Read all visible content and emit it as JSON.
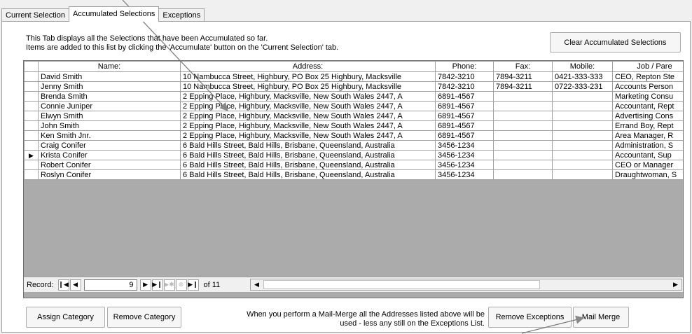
{
  "tabs": [
    {
      "label": "Current Selection"
    },
    {
      "label": "Accumulated Selections"
    },
    {
      "label": "Exceptions"
    }
  ],
  "info": {
    "line1": "This Tab displays all the Selections that have been Accumulated so far.",
    "line2": "Items are added to this list by clicking the 'Accumulate' button on the 'Current Selection' tab."
  },
  "buttons": {
    "clear_accumulated": "Clear Accumulated Selections",
    "assign_category": "Assign Category",
    "remove_category": "Remove Category",
    "remove_exceptions": "Remove Exceptions",
    "mail_merge": "Mail Merge"
  },
  "columns": [
    "Name:",
    "Address:",
    "Phone:",
    "Fax:",
    "Mobile:",
    "Job / Pare"
  ],
  "rows": [
    {
      "name": "David Smith",
      "address": "10 Nambucca Street, Highbury, PO Box 25 Highbury, Macksville",
      "phone": "7842-3210",
      "fax": "7894-3211",
      "mobile": "0421-333-333",
      "job": "CEO, Repton Ste"
    },
    {
      "name": "Jenny Smith",
      "address": "10 Nambucca Street, Highbury, PO Box 25 Highbury, Macksville",
      "phone": "7842-3210",
      "fax": "7894-3211",
      "mobile": "0722-333-231",
      "job": "Accounts Person"
    },
    {
      "name": "Brenda Smith",
      "address": "2 Epping Place, Highbury, Macksville, New South Wales 2447, A",
      "phone": "6891-4567",
      "fax": "",
      "mobile": "",
      "job": "Marketing Consu"
    },
    {
      "name": "Connie Juniper",
      "address": "2 Epping Place, Highbury, Macksville, New South Wales 2447, A",
      "phone": "6891-4567",
      "fax": "",
      "mobile": "",
      "job": "Accountant, Rept"
    },
    {
      "name": "Elwyn Smith",
      "address": "2 Epping Place, Highbury, Macksville, New South Wales 2447, A",
      "phone": "6891-4567",
      "fax": "",
      "mobile": "",
      "job": "Advertising Cons"
    },
    {
      "name": "John Smith",
      "address": "2 Epping Place, Highbury, Macksville, New South Wales 2447, A",
      "phone": "6891-4567",
      "fax": "",
      "mobile": "",
      "job": "Errand Boy, Rept"
    },
    {
      "name": "Ken Smith Jnr.",
      "address": "2 Epping Place, Highbury, Macksville, New South Wales 2447, A",
      "phone": "6891-4567",
      "fax": "",
      "mobile": "",
      "job": "Area Manager, R"
    },
    {
      "name": "Craig Conifer",
      "address": "6 Bald Hills Street, Bald Hills, Brisbane, Queensland, Australia",
      "phone": "3456-1234",
      "fax": "",
      "mobile": "",
      "job": "Administration, S"
    },
    {
      "name": "Krista Conifer",
      "address": "6 Bald Hills Street, Bald Hills, Brisbane, Queensland, Australia",
      "phone": "3456-1234",
      "fax": "",
      "mobile": "",
      "job": "Accountant, Sup"
    },
    {
      "name": "Robert Conifer",
      "address": "6 Bald Hills Street, Bald Hills, Brisbane, Queensland, Australia",
      "phone": "3456-1234",
      "fax": "",
      "mobile": "",
      "job": "CEO or Manager"
    },
    {
      "name": "Roslyn Conifer",
      "address": "6 Bald Hills Street, Bald Hills, Brisbane, Queensland, Australia",
      "phone": "3456-1234",
      "fax": "",
      "mobile": "",
      "job": "Draughtwoman, S"
    }
  ],
  "selected_row_marker": "▶",
  "navigation": {
    "label": "Record:",
    "current": "9",
    "of_text": "of 11"
  },
  "note": {
    "line1": "When you perform a Mail-Merge all the Addresses listed above will be",
    "line2": "used - less any still on the Exceptions List."
  },
  "icons": {
    "first": "first-record-icon",
    "prev": "previous-record-icon",
    "next": "next-record-icon",
    "last": "last-record-icon",
    "new": "new-record-icon",
    "delete": "delete-record-icon",
    "scroll_left": "scroll-left-icon",
    "scroll_right": "scroll-right-icon"
  }
}
